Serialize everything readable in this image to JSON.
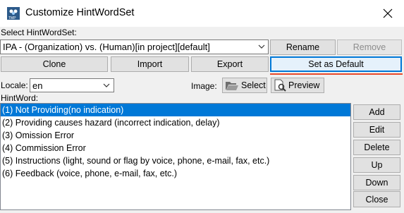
{
  "window": {
    "title": "Customize HintWordSet",
    "icon": "tmp-app-icon",
    "close_icon": "close-icon"
  },
  "select_label": "Select HintWordSet:",
  "hintwordset_select": {
    "value": "IPA - (Organization) vs. (Human)[in project][default]"
  },
  "buttons": {
    "rename": "Rename",
    "remove": "Remove",
    "clone": "Clone",
    "import": "Import",
    "export": "Export",
    "set_default": "Set as Default"
  },
  "locale": {
    "label": "Locale:",
    "value": "en"
  },
  "image": {
    "label": "Image:",
    "select": "Select",
    "preview": "Preview"
  },
  "hintword": {
    "label": "HintWord:",
    "items": [
      "(1) Not Providing(no indication)",
      "(2) Providing causes hazard (incorrect indication, delay)",
      "(3) Omission Error",
      "(4) Commission Error",
      "(5) Instructions (light, sound or flag by voice, phone, e-mail, fax, etc.)",
      "(6) Feedback (voice, phone, e-mail, fax, etc.)"
    ],
    "selected_index": 0
  },
  "side_buttons": {
    "add": "Add",
    "edit": "Edit",
    "delete": "Delete",
    "up": "Up",
    "down": "Down"
  },
  "close_button": "Close",
  "colors": {
    "selection": "#0078d7",
    "default_highlight": "#e84a2b",
    "window_bg": "#f0f0f0"
  }
}
